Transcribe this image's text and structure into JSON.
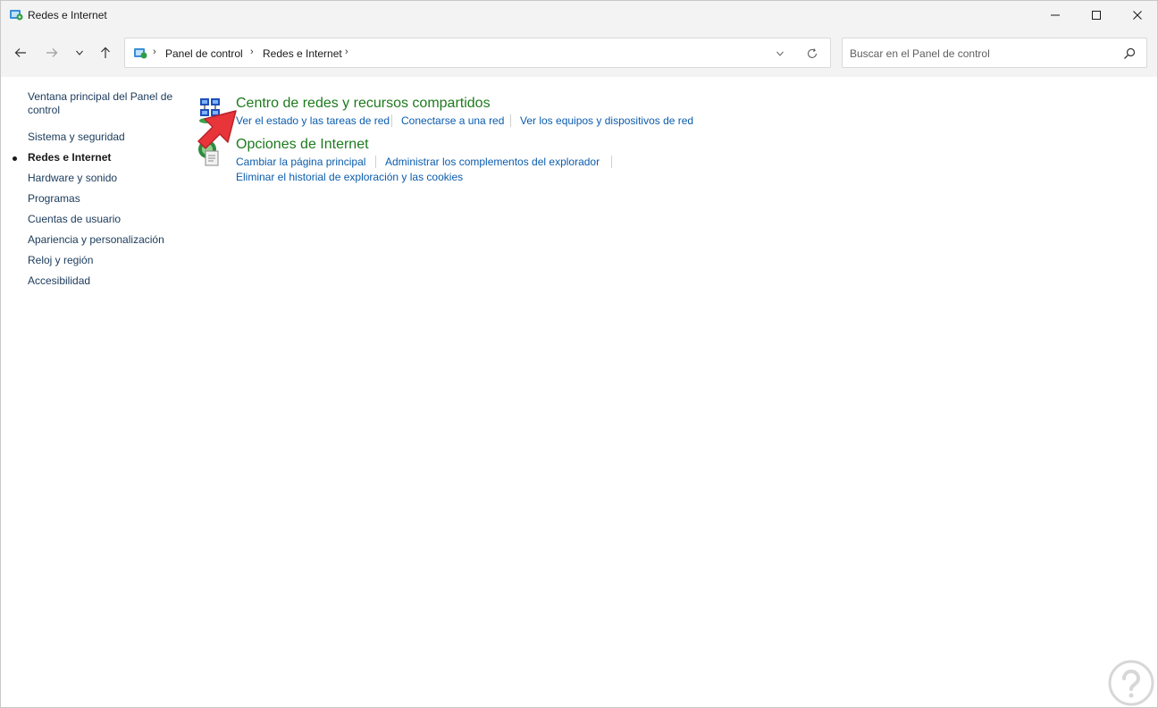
{
  "window": {
    "title": "Redes e Internet"
  },
  "navigation": {
    "breadcrumbs": [
      "Panel de control",
      "Redes e Internet"
    ],
    "search_placeholder": "Buscar en el Panel de control"
  },
  "sidebar": {
    "items": [
      {
        "label": "Ventana principal del Panel de",
        "label2": "control",
        "active": false
      },
      {
        "label": "Sistema y seguridad",
        "active": false
      },
      {
        "label": "Redes e Internet",
        "active": true
      },
      {
        "label": "Hardware y sonido",
        "active": false
      },
      {
        "label": "Programas",
        "active": false
      },
      {
        "label": "Cuentas de usuario",
        "active": false
      },
      {
        "label": "Apariencia y personalización",
        "active": false
      },
      {
        "label": "Reloj y región",
        "active": false
      },
      {
        "label": "Accesibilidad",
        "active": false
      }
    ]
  },
  "categories": [
    {
      "title": "Centro de redes y recursos compartidos",
      "icon": "network-center-icon",
      "links": [
        "Ver el estado y las tareas de red",
        "Conectarse a una red",
        "Ver los equipos y dispositivos de red"
      ]
    },
    {
      "title": "Opciones de Internet",
      "icon": "internet-options-icon",
      "links": [
        "Cambiar la página principal",
        "Administrar los complementos del explorador",
        "Eliminar el historial de exploración y las cookies"
      ]
    }
  ],
  "colors": {
    "category_title": "#1e7a1e",
    "link": "#0b5cad",
    "annotation_arrow": "#e8353a"
  }
}
